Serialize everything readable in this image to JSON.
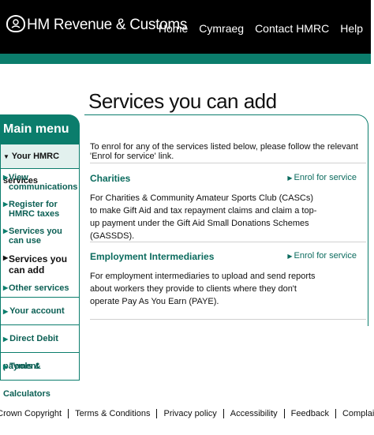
{
  "header": {
    "brand": "HM Revenue & Customs",
    "nav": [
      "Home",
      "Cymraeg",
      "Contact HMRC",
      "Help"
    ],
    "colors": {
      "bar": "#000000",
      "accent": "#0b7d6c"
    }
  },
  "page_title": "Services you can add",
  "sidebar": {
    "heading": "Main menu",
    "section": "Your HMRC services",
    "sub_items": [
      {
        "label": "View communications",
        "current": false
      },
      {
        "label": "Register for HMRC taxes",
        "current": false
      },
      {
        "label": "Services you can use",
        "current": false
      },
      {
        "label": "Services you can add",
        "current": true
      },
      {
        "label": "Other services",
        "current": false
      }
    ],
    "items": [
      "Your account",
      "Direct Debit payment",
      "Tools & Calculators"
    ]
  },
  "content": {
    "intro": "To enrol for any of the services listed below, please follow the relevant 'Enrol for service' link.",
    "services": [
      {
        "name": "Charities",
        "link": "Enrol for service",
        "description": "For Charities & Community Amateur Sports Club (CASCs) to make Gift Aid and tax repayment claims and claim a top-up payment under the Gift Aid Small Donations Schemes (GASSDS)."
      },
      {
        "name": "Employment Intermediaries",
        "link": "Enrol for service",
        "description": "For employment intermediaries to upload and send reports about workers they provide to clients where they don't operate Pay As You Earn (PAYE)."
      }
    ]
  },
  "footer": [
    "© Crown Copyright",
    "Terms & Conditions",
    "Privacy policy",
    "Accessibility",
    "Feedback",
    "Complaints"
  ]
}
